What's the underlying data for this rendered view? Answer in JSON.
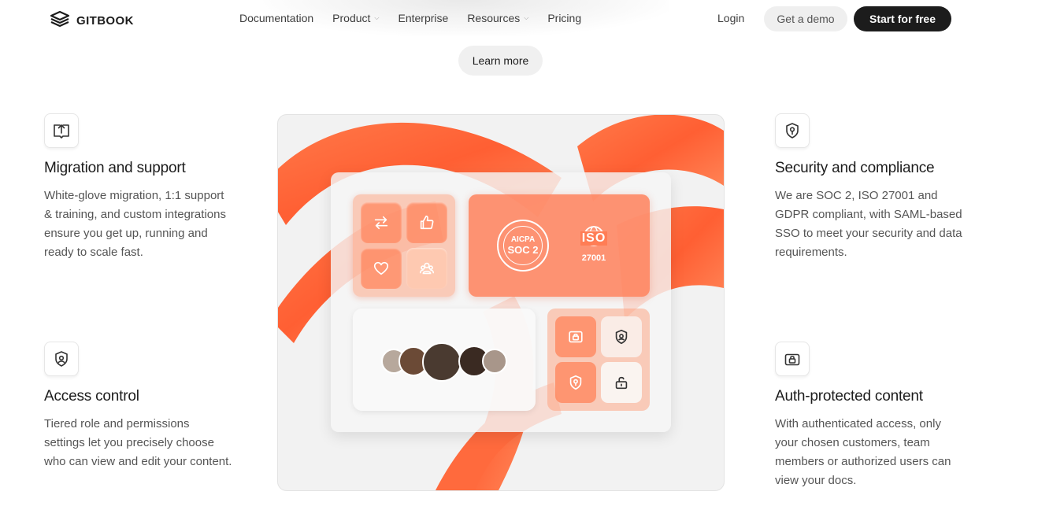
{
  "header": {
    "logo_text": "GITBOOK",
    "nav": [
      {
        "label": "Documentation",
        "has_menu": false
      },
      {
        "label": "Product",
        "has_menu": true
      },
      {
        "label": "Enterprise",
        "has_menu": false
      },
      {
        "label": "Resources",
        "has_menu": true
      },
      {
        "label": "Pricing",
        "has_menu": false
      }
    ],
    "login_label": "Login",
    "demo_label": "Get a demo",
    "start_label": "Start for free"
  },
  "learn_more_label": "Learn more",
  "features": {
    "migration": {
      "icon": "upload-book-icon",
      "title": "Migration and support",
      "description": "White-glove migration, 1:1 support & training, and custom integrations ensure you get up, running and ready to scale fast."
    },
    "access": {
      "icon": "shield-user-icon",
      "title": "Access control",
      "description": "Tiered role and permissions settings let you precisely choose who can view and edit your content."
    },
    "security": {
      "icon": "shield-lock-icon",
      "title": "Security and compliance",
      "description": "We are SOC 2, ISO 27001 and GDPR compliant, with SAML-based SSO to meet your security and data requirements."
    },
    "auth": {
      "icon": "lock-card-icon",
      "title": "Auth-protected content",
      "description": "With authenticated access, only your chosen customers, team members or authorized users can view your docs."
    }
  },
  "illustration": {
    "soc_badge": {
      "top": "AICPA",
      "main": "SOC 2"
    },
    "iso_badge": {
      "main": "ISO",
      "number": "27001"
    },
    "colors": {
      "accent": "#ff6a3d",
      "dark": "#1c1c1c"
    }
  }
}
